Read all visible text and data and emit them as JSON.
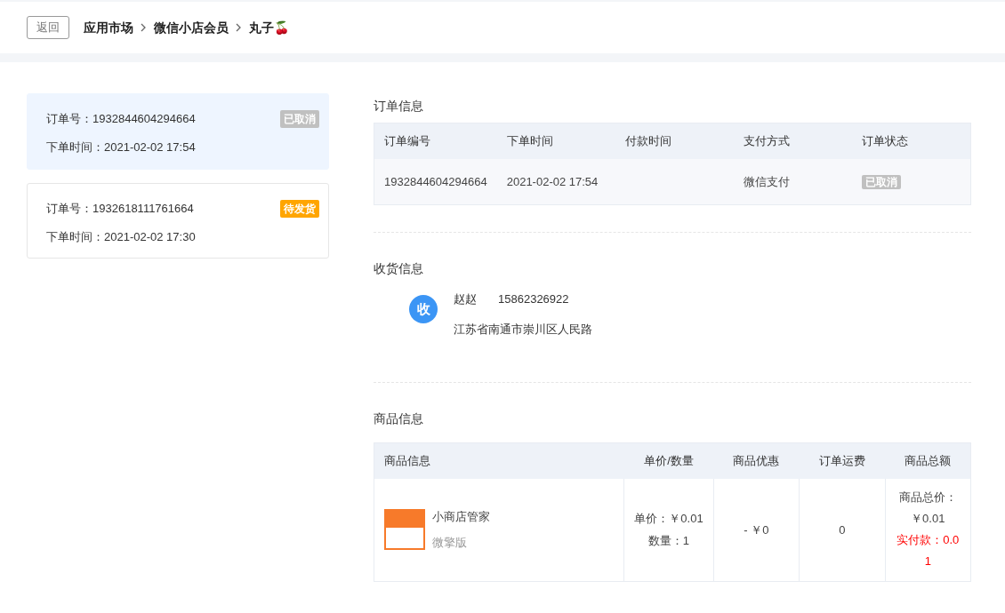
{
  "header": {
    "back_button": "返回",
    "breadcrumb": [
      {
        "label": "应用市场"
      },
      {
        "label": "微信小店会员"
      },
      {
        "label": "丸子🍒"
      }
    ]
  },
  "orders": [
    {
      "number_label": "订单号：",
      "number": "1932844604294664",
      "time_label": "下单时间：",
      "time": "2021-02-02 17:54",
      "status": "已取消",
      "color": "#c0c0c0",
      "selected": true
    },
    {
      "number_label": "订单号：",
      "number": "1932618111761664",
      "time_label": "下单时间：",
      "time": "2021-02-02 17:30",
      "status": "待发货",
      "color": "#ffa500",
      "selected": false
    }
  ],
  "order_info": {
    "title": "订单信息",
    "columns": [
      "订单编号",
      "下单时间",
      "付款时间",
      "支付方式",
      "订单状态"
    ],
    "row": {
      "number": "1932844604294664",
      "order_time": "2021-02-02 17:54",
      "pay_method": "微信支付",
      "status": "已取消",
      "color": "#c0c0c0"
    }
  },
  "shipping": {
    "title": "收货信息",
    "avatar": "收",
    "name": "赵赵",
    "phone": "15862326922",
    "address": "江苏省南通市崇川区人民路"
  },
  "goods": {
    "title": "商品信息",
    "columns": [
      "商品信息",
      "单价/数量",
      "商品优惠",
      "订单运费",
      "商品总额"
    ],
    "rows": [
      {
        "name": "小商店管家",
        "edition": "微擎版",
        "unit_price": "单价：￥0.01",
        "quantity": "数量：1",
        "discount": "- ￥0",
        "shipping_fee": "0",
        "total_label": "商品总价：",
        "total": "￥0.01",
        "paid": "实付款：0.01"
      }
    ]
  }
}
